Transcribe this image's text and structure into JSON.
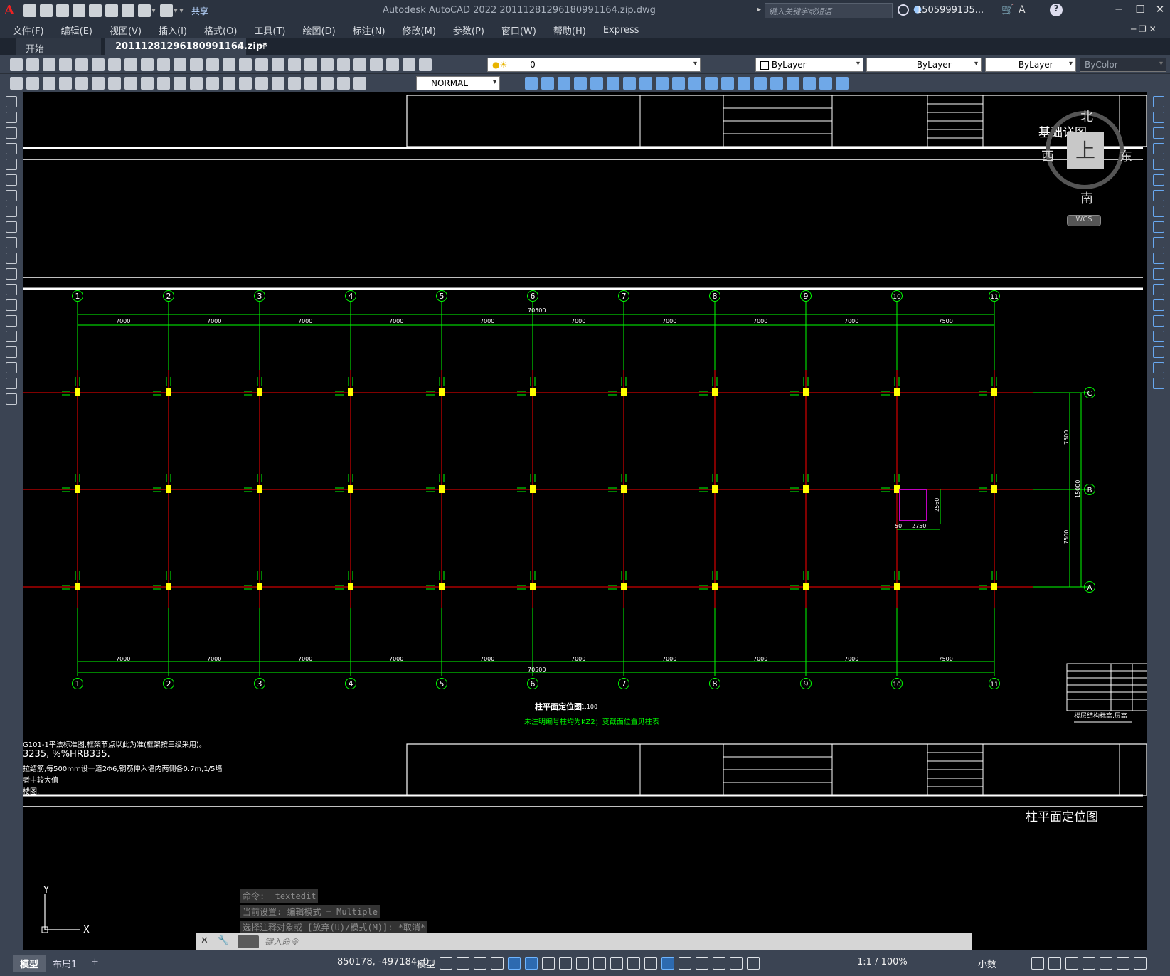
{
  "titlebar": {
    "app_title": "Autodesk AutoCAD 2022    20111281296180991164.zip.dwg",
    "share_label": "共享",
    "search_placeholder": "键入关键字或短语",
    "user_name": "1505999135...",
    "window_controls": [
      "minimize",
      "maximize",
      "close"
    ]
  },
  "menubar": {
    "items": [
      "文件(F)",
      "编辑(E)",
      "视图(V)",
      "插入(I)",
      "格式(O)",
      "工具(T)",
      "绘图(D)",
      "标注(N)",
      "修改(M)",
      "参数(P)",
      "窗口(W)",
      "帮助(H)",
      "Express"
    ]
  },
  "tabs": {
    "start": "开始",
    "file": "20111281296180991164.zip*"
  },
  "toolbar": {
    "layer_value": "0",
    "color_value": "ByLayer",
    "linetype_value": "ByLayer",
    "lineweight_value": "ByLayer",
    "plotstyle_value": "ByColor",
    "textstyle_value": "NORMAL"
  },
  "viewcube": {
    "north": "北",
    "south": "南",
    "west": "西",
    "east": "东",
    "face": "上",
    "wcs": "WCS"
  },
  "drawing": {
    "title_top_right": "基础详图",
    "title_bottom_right": "柱平面定位图",
    "plan_title": "柱平面定位图",
    "plan_scale": "1:100",
    "plan_note": "未注明编号柱均为KZ2；变截面位置见柱表",
    "axes": [
      "1",
      "2",
      "3",
      "4",
      "5",
      "6",
      "7",
      "8",
      "9",
      "10",
      "11"
    ],
    "row_axes": [
      "C",
      "B",
      "A"
    ],
    "spans": [
      "7000",
      "7000",
      "7000",
      "7000",
      "7000",
      "7000",
      "7000",
      "7000",
      "7000",
      "7500"
    ],
    "total_length": "70500",
    "row_spans": [
      "7500",
      "7500"
    ],
    "total_width": "15000",
    "notes": [
      "G101-1平法标准图,框架节点以此为准(框架按三级采用)。",
      "3235, %%HRB335.",
      "拉结筋,每500mm设一道2Φ6,钢筋伸入墙内两侧各0.7m,1/5墙",
      "者中较大值",
      "楼图."
    ],
    "detail_dims": [
      "2750",
      "2560",
      "50"
    ],
    "level_table_title": "楼层结构标高,层高"
  },
  "command": {
    "history": [
      "命令: _textedit",
      "当前设置: 编辑模式 = Multiple",
      "选择注释对象或 [放弃(U)/模式(M)]: *取消*"
    ],
    "placeholder": "键入命令"
  },
  "statusbar": {
    "layout_model": "模型",
    "layout_1": "布局1",
    "add": "+",
    "coords": "850178, -497184, 0",
    "model": "模型",
    "scale": "1:1 / 100%",
    "units": "小数"
  },
  "colors": {
    "grid_green": "#00ff00",
    "beam_red": "#ff0000",
    "column_yellow": "#ffff00",
    "frame_white": "#ffffff",
    "ui_dark": "#3b4453"
  }
}
